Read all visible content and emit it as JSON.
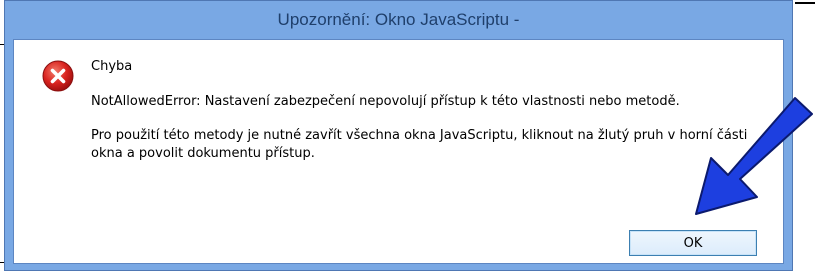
{
  "dialog": {
    "title": "Upozornění: Okno JavaScriptu -",
    "heading": "Chyba",
    "message_line1": "NotAllowedError: Nastavení zabezpečení nepovolují přístup k této vlastnosti nebo metodě.",
    "message_line2": "Pro použití této metody je nutné zavřít všechna okna JavaScriptu, kliknout na žlutý pruh v horní části",
    "message_line3": "okna a povolit dokumentu přístup.",
    "ok_label": "OK",
    "icon": "error-icon"
  },
  "annotation": {
    "icon": "arrow-pointer",
    "color": "#1d3fe0"
  },
  "colors": {
    "frame": "#79a8e4",
    "error_red": "#d9231f"
  }
}
